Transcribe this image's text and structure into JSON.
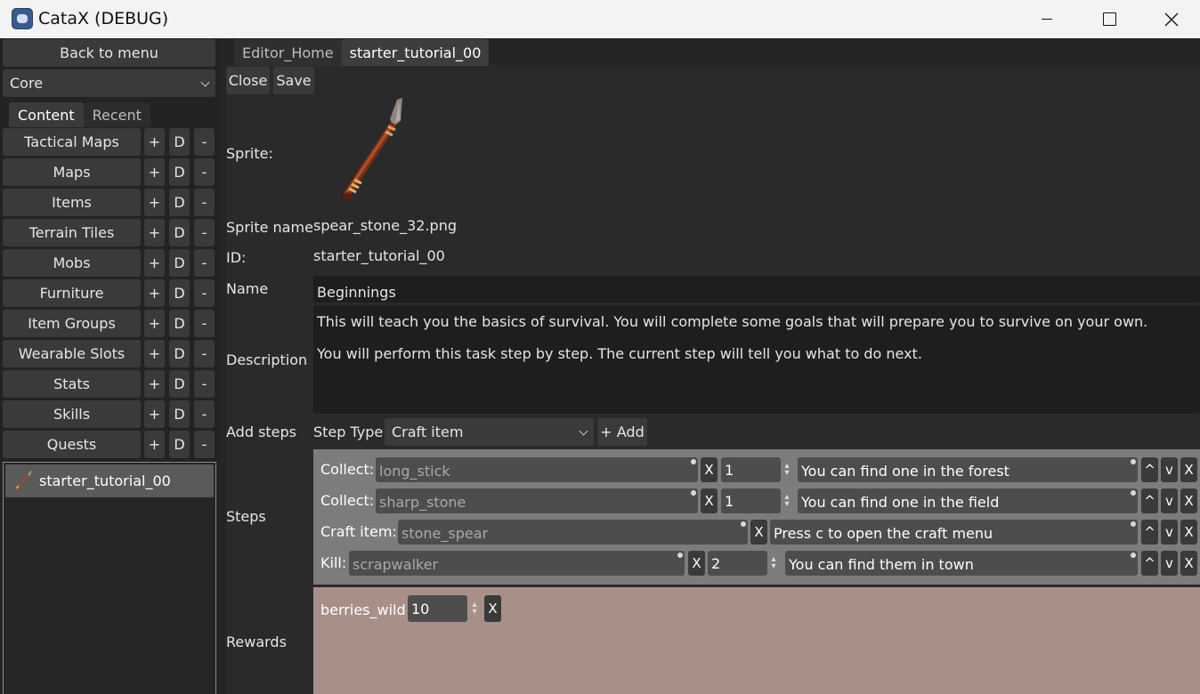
{
  "window": {
    "title": "CataX (DEBUG)"
  },
  "sidebar": {
    "back_label": "Back to menu",
    "mod_select": "Core",
    "tabs": [
      "Content",
      "Recent"
    ],
    "categories": [
      {
        "label": "Tactical Maps"
      },
      {
        "label": "Maps"
      },
      {
        "label": "Items"
      },
      {
        "label": "Terrain Tiles"
      },
      {
        "label": "Mobs"
      },
      {
        "label": "Furniture"
      },
      {
        "label": "Item Groups"
      },
      {
        "label": "Wearable Slots"
      },
      {
        "label": "Stats"
      },
      {
        "label": "Skills"
      },
      {
        "label": "Quests"
      }
    ],
    "row_buttons": {
      "add": "+",
      "dup": "D",
      "remove": "-"
    },
    "selected_item": "starter_tutorial_00"
  },
  "main": {
    "tabs": [
      "Editor_Home",
      "starter_tutorial_00"
    ],
    "toolbar": {
      "close_label": "Close",
      "save_label": "Save"
    },
    "fields": {
      "sprite_label": "Sprite:",
      "sprite_name_label": "Sprite name",
      "sprite_name": "spear_stone_32.png",
      "id_label": "ID:",
      "id": "starter_tutorial_00",
      "name_label": "Name",
      "name": "Beginnings",
      "description_label": "Description",
      "description_p1": "This will teach you the basics of survival. You will complete some goals that will prepare you to survive on your own.",
      "description_p2": "You will perform this task step by step. The current step will tell you what to do next.",
      "add_steps_label": "Add steps",
      "step_type_label": "Step Type",
      "step_type": "Craft item",
      "add_button": "+ Add",
      "steps_label": "Steps",
      "rewards_label": "Rewards"
    },
    "steps": [
      {
        "type": "Collect:",
        "item": "long_stick",
        "count": "1",
        "hint": "You can find one in the forest"
      },
      {
        "type": "Collect:",
        "item": "sharp_stone",
        "count": "1",
        "hint": "You can find one in the field"
      },
      {
        "type": "Craft item:",
        "item": "stone_spear",
        "hint": "Press c to open the craft menu"
      },
      {
        "type": "Kill:",
        "item": "scrapwalker",
        "count": "2",
        "hint": "You can find them in town"
      }
    ],
    "step_buttons": {
      "x": "X",
      "up": "^",
      "down": "v",
      "delete": "X"
    },
    "rewards": [
      {
        "item": "berries_wild",
        "count": "10",
        "remove": "X"
      }
    ]
  }
}
